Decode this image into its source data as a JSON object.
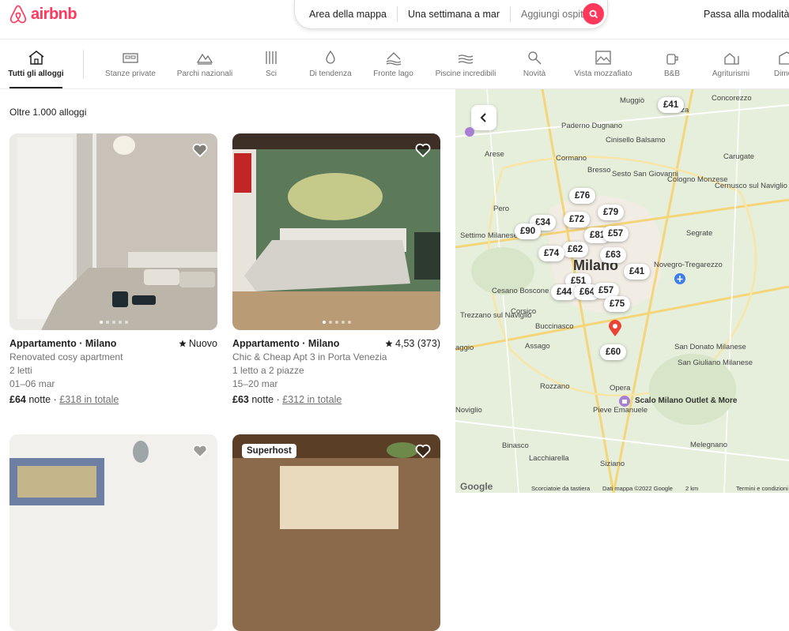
{
  "header": {
    "logo_text": "airbnb",
    "search": {
      "location": "Area della mappa",
      "dates": "Una settimana a mar",
      "guests": "Aggiungi ospiti"
    },
    "host_link": "Passa alla modalità host"
  },
  "categories": [
    {
      "label": "Tutti gli alloggi",
      "icon": "home-icon",
      "active": true
    },
    {
      "label": "Stanze private",
      "icon": "bed-icon"
    },
    {
      "label": "Parchi nazionali",
      "icon": "park-icon"
    },
    {
      "label": "Sci",
      "icon": "ski-icon"
    },
    {
      "label": "Di tendenza",
      "icon": "flame-icon"
    },
    {
      "label": "Fronte lago",
      "icon": "lake-icon"
    },
    {
      "label": "Piscine incredibili",
      "icon": "pool-icon"
    },
    {
      "label": "Novità",
      "icon": "sparkle-key-icon"
    },
    {
      "label": "Vista mozzafiato",
      "icon": "view-icon"
    },
    {
      "label": "B&B",
      "icon": "breakfast-icon"
    },
    {
      "label": "Agriturismi",
      "icon": "farm-icon"
    },
    {
      "label": "Dimore",
      "icon": "mansion-icon"
    }
  ],
  "results_count": "Oltre 1.000 alloggi",
  "listings": [
    {
      "title": "Appartamento · Milano",
      "rating": "Nuovo",
      "name": "Renovated cosy apartment",
      "beds": "2 letti",
      "dates": "01–06 mar",
      "price": "£64",
      "per": " notte · ",
      "total": "£318 in totale"
    },
    {
      "title": "Appartamento · Milano",
      "rating": "4,53 (373)",
      "name": "Chic & Cheap Apt 3 in Porta Venezia",
      "beds": "1 letto a 2 piazze",
      "dates": "15–20 mar",
      "price": "£63",
      "per": " notte · ",
      "total": "£312 in totale"
    },
    {
      "badge": ""
    },
    {
      "badge": "Superhost"
    }
  ],
  "map": {
    "price_pins": [
      "£41",
      "£76",
      "£79",
      "£34",
      "£72",
      "£90",
      "£81",
      "£57",
      "£62",
      "£74",
      "£63",
      "£41",
      "£51",
      "£44",
      "£64",
      "£57",
      "£75",
      "£60"
    ],
    "places": [
      "Muggiò",
      "Paderno Dugnano",
      "Cinisello Balsamo",
      "Arese",
      "Cormano",
      "Bresso",
      "Sesto San Giovanni",
      "Cologno Monzese",
      "Cernusco sul Naviglio",
      "Concorezzo",
      "Carugate",
      "Pero",
      "Settimo Milanese",
      "Segrate",
      "Milano",
      "Novegro-Tregarezzo",
      "Cesano Boscone",
      "Trezzano sul Naviglio",
      "Buccinasco",
      "Corsico",
      "Assago",
      "San Donato Milanese",
      "San Giuliano Milanese",
      "Rozzano",
      "Opera",
      "Pieve Emanuele",
      "Noviglio",
      "Binasco",
      "Lacchiarella",
      "Siziano",
      "Melegnano",
      "aggio",
      "nza"
    ],
    "outlet": "Scalo Milano Outlet & More",
    "footer": {
      "logo": "Google",
      "shortcuts": "Scorciatoie da tastiera",
      "mapdata": "Dati mappa ©2022 Google",
      "scale": "2 km",
      "terms": "Termini e condizioni"
    }
  }
}
